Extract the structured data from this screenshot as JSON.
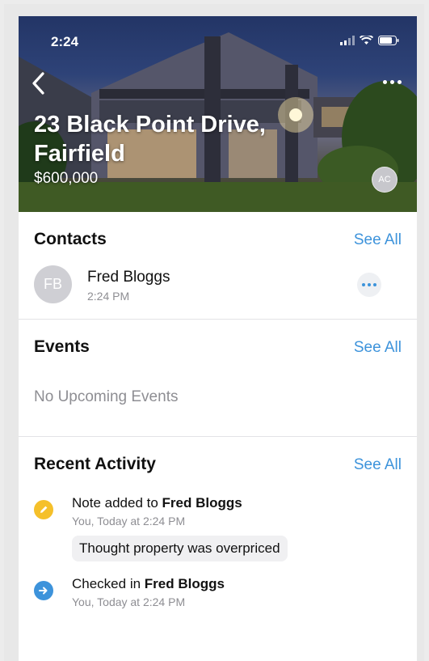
{
  "status_bar": {
    "time": "2:24"
  },
  "header": {
    "address": "23 Black Point Drive, Fairfield",
    "price": "$600,000",
    "agent_initials": "AC",
    "icons": {
      "back": "chevron-left-icon",
      "more": "more-horizontal-icon"
    }
  },
  "contacts": {
    "title": "Contacts",
    "see_all": "See All",
    "items": [
      {
        "initials": "FB",
        "name": "Fred Bloggs",
        "time": "2:24 PM"
      }
    ]
  },
  "events": {
    "title": "Events",
    "see_all": "See All",
    "empty": "No Upcoming Events"
  },
  "activity": {
    "title": "Recent Activity",
    "see_all": "See All",
    "items": [
      {
        "icon": "pencil-icon",
        "icon_color": "#f5c02a",
        "prefix": "Note added to ",
        "subject": "Fred Bloggs",
        "meta": "You, Today at 2:24 PM",
        "note": "Thought property was overpriced"
      },
      {
        "icon": "arrow-right-icon",
        "icon_color": "#3d93db",
        "prefix": "Checked in ",
        "subject": "Fred Bloggs",
        "meta": "You, Today at 2:24 PM"
      }
    ]
  },
  "colors": {
    "accent": "#3d93db",
    "muted": "#8e8e93"
  }
}
